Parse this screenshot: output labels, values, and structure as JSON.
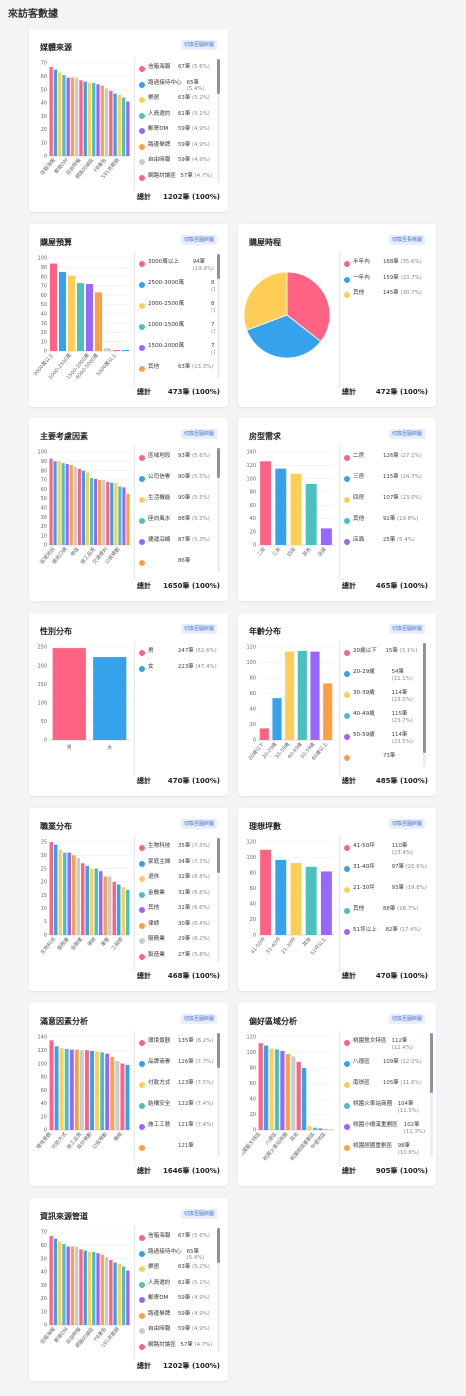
{
  "page_title": "來訪客數據",
  "toggle_label": "切換至圓餅圖",
  "toggle_label_bar": "切換至長條圖",
  "total_label": "總計",
  "colors": [
    "#ff6384",
    "#36a2eb",
    "#ffce56",
    "#4bc0c0",
    "#9966ff",
    "#ff9f40",
    "#c9cbcf",
    "#ff6384"
  ],
  "cards": [
    {
      "id": "media",
      "title": "媒體來源",
      "toggle": "切換至圓餅圖",
      "total": "1202筆 (100%)",
      "chart_data": {
        "type": "bar",
        "ylim": [
          0,
          70
        ],
        "yticks": [
          "0",
          "10",
          "20",
          "30",
          "40",
          "50",
          "60",
          "70"
        ],
        "xticklabels": [
          "信箱海報",
          "郵寄DM",
          "自由時報",
          "網路討論區",
          "FB廣告",
          "591房屋網"
        ],
        "values": [
          67,
          65,
          63,
          61,
          59,
          59,
          59,
          57,
          56,
          55,
          55,
          54,
          53,
          51,
          49,
          47,
          46,
          44,
          41
        ]
      },
      "legend": [
        {
          "name": "信箱海報",
          "val": "67筆",
          "pct": "(5.6%)"
        },
        {
          "name": "路過接待中心",
          "val": "65筆",
          "pct": "(5.4%)"
        },
        {
          "name": "樂居",
          "val": "63筆",
          "pct": "(5.2%)"
        },
        {
          "name": "人員邀約",
          "val": "61筆",
          "pct": "(5.1%)"
        },
        {
          "name": "郵寄DM",
          "val": "59筆",
          "pct": "(4.9%)"
        },
        {
          "name": "路邊舉牌",
          "val": "59筆",
          "pct": "(4.9%)"
        },
        {
          "name": "自由時報",
          "val": "59筆",
          "pct": "(4.9%)"
        },
        {
          "name": "網路討論區",
          "val": "57筆",
          "pct": "(4.7%)"
        }
      ]
    },
    {
      "id": "budget",
      "title": "購屋預算",
      "toggle": "切換至圓餅圖",
      "total": "473筆 (100%)",
      "chart_data": {
        "type": "bar",
        "ylim": [
          0,
          100
        ],
        "yticks": [
          "0",
          "10",
          "20",
          "30",
          "40",
          "50",
          "60",
          "70",
          "80",
          "90",
          "100"
        ],
        "xticklabels": [
          "3000萬以上",
          "2000-2500萬",
          "1500-2000萬",
          "4000-5000萬",
          "5000萬以上"
        ],
        "values": [
          94,
          85,
          81,
          73,
          72,
          63,
          3,
          1,
          1
        ]
      },
      "legend": [
        {
          "name": "3000萬以上",
          "val": "94筆",
          "pct": "(19.9%)"
        },
        {
          "name": "2500-3000萬",
          "val": "85筆",
          "pct": "(18.0%)"
        },
        {
          "name": "2000-2500萬",
          "val": "81筆",
          "pct": "(17.1%)"
        },
        {
          "name": "1000-1500萬",
          "val": "73筆",
          "pct": "(15.4%)"
        },
        {
          "name": "1500-2000萬",
          "val": "72筆",
          "pct": "(15.2%)"
        },
        {
          "name": "其他",
          "val": "63筆",
          "pct": "(13.3%)"
        }
      ]
    },
    {
      "id": "timeline",
      "title": "購屋時程",
      "toggle": "切換至長條圖",
      "total": "472筆 (100%)",
      "chart_data": {
        "type": "pie",
        "labels": [
          "半年內",
          "一年內",
          "其他"
        ],
        "values": [
          168,
          159,
          145
        ]
      },
      "legend": [
        {
          "name": "半年內",
          "val": "168筆",
          "pct": "(35.6%)"
        },
        {
          "name": "一年內",
          "val": "159筆",
          "pct": "(33.7%)"
        },
        {
          "name": "其他",
          "val": "145筆",
          "pct": "(30.7%)"
        }
      ]
    },
    {
      "id": "factors",
      "title": "主要考慮因素",
      "toggle": "切換至圓餅圖",
      "total": "1650筆 (100%)",
      "chart_data": {
        "type": "bar",
        "ylim": [
          0,
          100
        ],
        "yticks": [
          "0",
          "10",
          "20",
          "30",
          "40",
          "50",
          "60",
          "70",
          "80",
          "90",
          "100"
        ],
        "xticklabels": [
          "區域地段",
          "建商口碑",
          "學區",
          "施工品質",
          "交通便利",
          "公設規劃"
        ],
        "values": [
          93,
          90,
          90,
          88,
          87,
          86,
          84,
          82,
          80,
          78,
          72,
          71,
          70,
          70,
          68,
          67,
          67,
          63,
          62,
          55
        ]
      },
      "legend": [
        {
          "name": "區域地段",
          "val": "93筆",
          "pct": "(5.6%)"
        },
        {
          "name": "公司信譽",
          "val": "90筆",
          "pct": "(5.5%)"
        },
        {
          "name": "生活機能",
          "val": "90筆",
          "pct": "(5.5%)"
        },
        {
          "name": "座向風水",
          "val": "88筆",
          "pct": "(5.3%)"
        },
        {
          "name": "捷運沿線",
          "val": "87筆",
          "pct": "(5.3%)"
        },
        {
          "name": "",
          "val": "86筆",
          "pct": ""
        }
      ]
    },
    {
      "id": "rooms",
      "title": "房型需求",
      "toggle": "切換至圓餅圖",
      "total": "465筆 (100%)",
      "chart_data": {
        "type": "bar",
        "ylim": [
          0,
          140
        ],
        "yticks": [
          "0",
          "20",
          "40",
          "60",
          "80",
          "100",
          "120",
          "140"
        ],
        "xticklabels": [
          "二房",
          "三房",
          "四房",
          "其他",
          "店面"
        ],
        "values": [
          126,
          115,
          107,
          92,
          25
        ]
      },
      "legend": [
        {
          "name": "二房",
          "val": "126筆",
          "pct": "(27.1%)"
        },
        {
          "name": "三房",
          "val": "115筆",
          "pct": "(24.7%)"
        },
        {
          "name": "四房",
          "val": "107筆",
          "pct": "(23.0%)"
        },
        {
          "name": "其他",
          "val": "92筆",
          "pct": "(19.8%)"
        },
        {
          "name": "店面",
          "val": "25筆",
          "pct": "(5.4%)"
        }
      ]
    },
    {
      "id": "gender",
      "title": "性別分布",
      "toggle": "切換至圓餅圖",
      "total": "470筆 (100%)",
      "chart_data": {
        "type": "bar",
        "ylim": [
          0,
          250
        ],
        "yticks": [
          "0",
          "50",
          "100",
          "150",
          "200",
          "250"
        ],
        "xticklabels": [
          "男",
          "女"
        ],
        "values": [
          247,
          223
        ]
      },
      "legend": [
        {
          "name": "男",
          "val": "247筆",
          "pct": "(52.6%)"
        },
        {
          "name": "女",
          "val": "223筆",
          "pct": "(47.4%)"
        }
      ]
    },
    {
      "id": "age",
      "title": "年齡分布",
      "toggle": "切換至圓餅圖",
      "total": "485筆 (100%)",
      "chart_data": {
        "type": "bar",
        "ylim": [
          0,
          120
        ],
        "yticks": [
          "0",
          "20",
          "40",
          "60",
          "80",
          "100",
          "120"
        ],
        "xticklabels": [
          "20歲以下",
          "20-29歲",
          "30-39歲",
          "40-49歲",
          "50-59歲",
          "60歲以上"
        ],
        "values": [
          15,
          54,
          114,
          115,
          114,
          73
        ]
      },
      "legend": [
        {
          "name": "20歲以下",
          "val": "15筆",
          "pct": "(3.1%)"
        },
        {
          "name": "20-29歲",
          "val": "54筆",
          "pct": "(11.1%)"
        },
        {
          "name": "30-39歲",
          "val": "114筆",
          "pct": "(23.5%)"
        },
        {
          "name": "40-49歲",
          "val": "115筆",
          "pct": "(23.7%)"
        },
        {
          "name": "50-59歲",
          "val": "114筆",
          "pct": "(23.5%)"
        },
        {
          "name": "",
          "val": "73筆",
          "pct": ""
        }
      ]
    },
    {
      "id": "job",
      "title": "職業分布",
      "toggle": "切換至圓餅圖",
      "total": "468筆 (100%)",
      "chart_data": {
        "type": "bar",
        "ylim": [
          0,
          35
        ],
        "yticks": [
          "0",
          "5",
          "10",
          "15",
          "20",
          "25",
          "30",
          "35"
        ],
        "xticklabels": [
          "生物科技",
          "服務業",
          "金融業",
          "律師",
          "軍警",
          "工程師"
        ],
        "values": [
          35,
          34,
          32,
          31,
          31,
          30,
          29,
          27,
          26,
          25,
          25,
          24,
          22,
          22,
          20,
          19,
          18,
          17
        ]
      },
      "legend": [
        {
          "name": "生物科技",
          "val": "35筆",
          "pct": "(7.5%)"
        },
        {
          "name": "家庭主婦",
          "val": "34筆",
          "pct": "(7.3%)"
        },
        {
          "name": "退休",
          "val": "32筆",
          "pct": "(6.8%)"
        },
        {
          "name": "金融業",
          "val": "31筆",
          "pct": "(6.6%)"
        },
        {
          "name": "其他",
          "val": "31筆",
          "pct": "(6.6%)"
        },
        {
          "name": "律師",
          "val": "30筆",
          "pct": "(6.4%)"
        },
        {
          "name": "服務業",
          "val": "29筆",
          "pct": "(6.2%)"
        },
        {
          "name": "製造業",
          "val": "27筆",
          "pct": "(5.8%)"
        }
      ]
    },
    {
      "id": "area",
      "title": "理想坪數",
      "toggle": "切換至圓餅圖",
      "total": "470筆 (100%)",
      "chart_data": {
        "type": "bar",
        "ylim": [
          0,
          120
        ],
        "yticks": [
          "0",
          "20",
          "40",
          "60",
          "80",
          "100",
          "120"
        ],
        "xticklabels": [
          "41-50坪",
          "31-40坪",
          "21-30坪",
          "其他",
          "51坪以上"
        ],
        "values": [
          110,
          97,
          93,
          88,
          82
        ]
      },
      "legend": [
        {
          "name": "41-50坪",
          "val": "110筆",
          "pct": "(23.4%)"
        },
        {
          "name": "31-40坪",
          "val": "97筆",
          "pct": "(20.6%)"
        },
        {
          "name": "21-30坪",
          "val": "93筆",
          "pct": "(19.8%)"
        },
        {
          "name": "其他",
          "val": "88筆",
          "pct": "(18.7%)"
        },
        {
          "name": "51坪以上",
          "val": "82筆",
          "pct": "(17.4%)"
        }
      ]
    },
    {
      "id": "satisfaction",
      "title": "滿意因素分析",
      "toggle": "切換至圓餅圖",
      "total": "1646筆 (100%)",
      "chart_data": {
        "type": "bar",
        "ylim": [
          0,
          140
        ],
        "yticks": [
          "0",
          "20",
          "40",
          "60",
          "80",
          "100",
          "120",
          "140"
        ],
        "xticklabels": [
          "環境景觀",
          "付款方式",
          "旅工品質",
          "設計規劃",
          "公設規劃",
          "價格"
        ],
        "values": [
          135,
          126,
          123,
          122,
          121,
          121,
          120,
          120,
          119,
          118,
          117,
          115,
          110,
          104,
          100,
          98
        ]
      },
      "legend": [
        {
          "name": "環境景觀",
          "val": "135筆",
          "pct": "(8.2%)"
        },
        {
          "name": "品牌商譽",
          "val": "126筆",
          "pct": "(7.7%)"
        },
        {
          "name": "付款方式",
          "val": "123筆",
          "pct": "(7.5%)"
        },
        {
          "name": "結構安全",
          "val": "122筆",
          "pct": "(7.4%)"
        },
        {
          "name": "施工工藝",
          "val": "121筆",
          "pct": "(7.4%)"
        },
        {
          "name": "",
          "val": "121筆",
          "pct": ""
        }
      ]
    },
    {
      "id": "region",
      "title": "偏好區域分析",
      "toggle": "切換至圓餅圖",
      "total": "905筆 (100%)",
      "chart_data": {
        "type": "bar",
        "ylim": [
          0,
          120
        ],
        "yticks": [
          "0",
          "20",
          "40",
          "60",
          "80",
          "100",
          "120"
        ],
        "xticklabels": [
          "桃園藝文特區",
          "八德區",
          "桃園火車站商圈",
          "其他",
          "桃園經國重劃區",
          "中壢地區"
        ],
        "values": [
          112,
          109,
          105,
          104,
          102,
          98,
          95,
          88,
          80,
          5,
          3,
          2,
          1,
          1
        ]
      },
      "legend": [
        {
          "name": "桃園藝文特區",
          "val": "112筆",
          "pct": "(12.4%)"
        },
        {
          "name": "八德區",
          "val": "109筆",
          "pct": "(12.0%)"
        },
        {
          "name": "南崁區",
          "val": "105筆",
          "pct": "(11.6%)"
        },
        {
          "name": "桃園火車站商圈",
          "val": "104筆",
          "pct": "(11.5%)"
        },
        {
          "name": "桃園小檜溪重劃區",
          "val": "102筆",
          "pct": "(11.3%)"
        },
        {
          "name": "桃園經國重劃區",
          "val": "98筆",
          "pct": "(10.8%)"
        }
      ]
    },
    {
      "id": "channel",
      "title": "資訊來源管道",
      "toggle": "切換至圓餅圖",
      "total": "1202筆 (100%)",
      "chart_data": {
        "type": "bar",
        "ylim": [
          0,
          70
        ],
        "yticks": [
          "0",
          "10",
          "20",
          "30",
          "40",
          "50",
          "60",
          "70"
        ],
        "xticklabels": [
          "信箱海報",
          "郵寄DM",
          "自由時報",
          "網路討論區",
          "FB廣告",
          "591房屋網"
        ],
        "values": [
          67,
          65,
          63,
          61,
          59,
          59,
          59,
          57,
          56,
          55,
          55,
          54,
          53,
          51,
          49,
          47,
          46,
          44,
          41
        ]
      },
      "legend": [
        {
          "name": "信箱海報",
          "val": "67筆",
          "pct": "(5.6%)"
        },
        {
          "name": "路過接待中心",
          "val": "65筆",
          "pct": "(5.4%)"
        },
        {
          "name": "樂居",
          "val": "63筆",
          "pct": "(5.2%)"
        },
        {
          "name": "人員邀約",
          "val": "61筆",
          "pct": "(5.1%)"
        },
        {
          "name": "郵寄DM",
          "val": "59筆",
          "pct": "(4.9%)"
        },
        {
          "name": "路邊舉牌",
          "val": "59筆",
          "pct": "(4.9%)"
        },
        {
          "name": "自由時報",
          "val": "59筆",
          "pct": "(4.9%)"
        },
        {
          "name": "網路討論區",
          "val": "57筆",
          "pct": "(4.7%)"
        }
      ]
    }
  ]
}
